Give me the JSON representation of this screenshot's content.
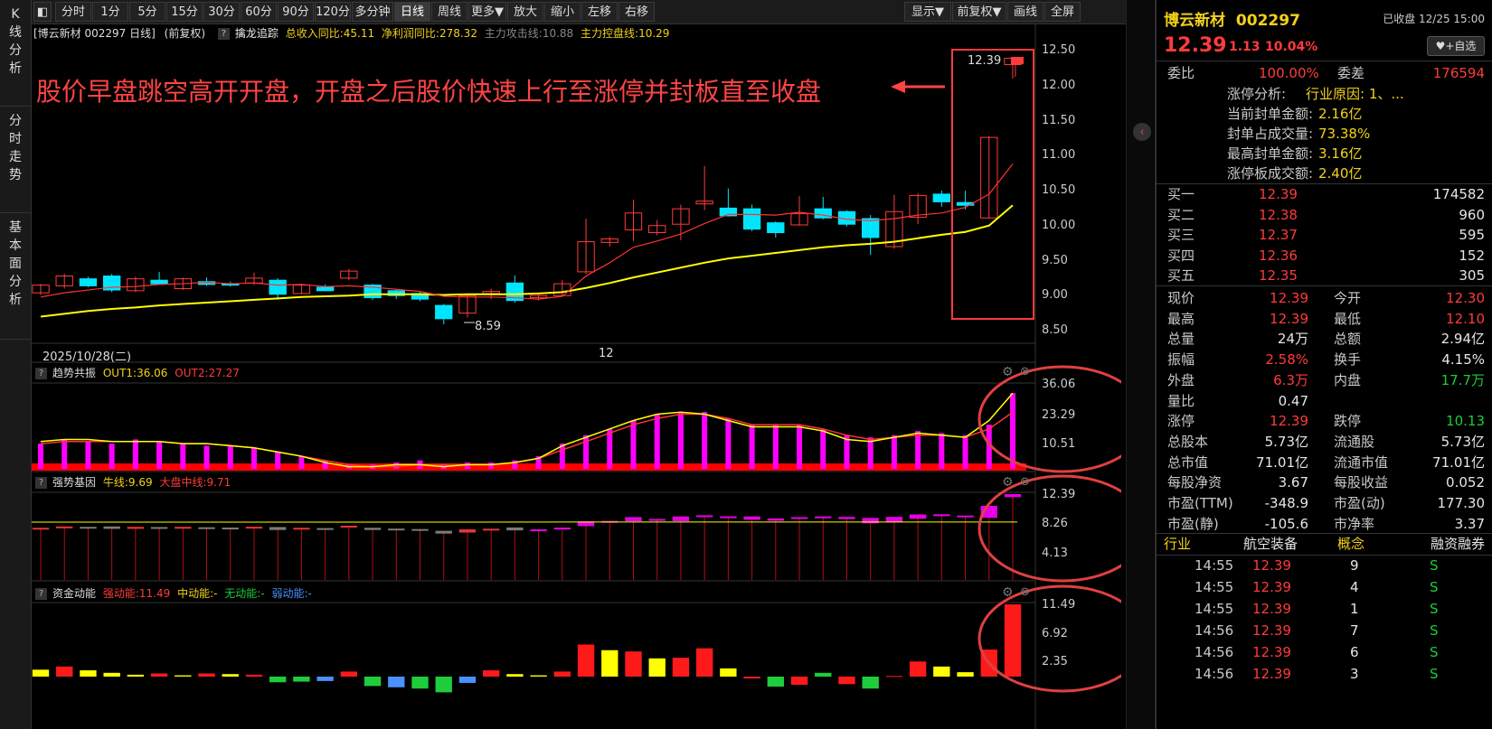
{
  "toolbar": {
    "buttons": [
      "分时",
      "1分",
      "5分",
      "15分",
      "30分",
      "60分",
      "90分",
      "120分",
      "多分钟",
      "日线",
      "周线",
      "更多▼",
      "放大",
      "缩小",
      "左移",
      "右移"
    ],
    "right_buttons": [
      "显示▼",
      "前复权▼",
      "画线",
      "全屏"
    ],
    "active": "日线"
  },
  "leftbar": {
    "tabs": [
      "K线分析",
      "分时走势",
      "基本面分析"
    ]
  },
  "chart_header": {
    "title": "[博云新材 002297 日线]",
    "adj": "(前复权)",
    "indicator": "擒龙追踪",
    "rev_growth": "总收入同比:45.11",
    "profit_growth": "净利润同比:278.32",
    "attack_line": "主力攻击线:10.88",
    "control_line": "主力控盘线:10.29"
  },
  "annotation": {
    "text": "股价早盘跳空高开开盘，开盘之后股价快速上行至涨停并封板直至收盘",
    "last_price_tag": "12.39",
    "low_label": "8.59"
  },
  "date_axis": {
    "left_label": "2025/10/28(二)",
    "mid_label": "12"
  },
  "price_axis": [
    "12.50",
    "12.00",
    "11.50",
    "11.00",
    "10.50",
    "10.00",
    "9.50",
    "9.00",
    "8.50"
  ],
  "panel1": {
    "name": "趋势共振",
    "out1": "OUT1:36.06",
    "out2": "OUT2:27.27",
    "axis": [
      "36.06",
      "23.29",
      "10.51"
    ]
  },
  "panel2": {
    "name": "强势基因",
    "bull": "牛线:9.69",
    "market": "大盘中线:9.71",
    "axis": [
      "12.39",
      "8.26",
      "4.13"
    ]
  },
  "panel3": {
    "name": "资金动能",
    "strong": "强动能:11.49",
    "mid": "中动能:-",
    "none": "无动能:-",
    "weak": "弱动能:-",
    "axis": [
      "11.49",
      "6.92",
      "2.35"
    ]
  },
  "colors": {
    "up": "#ff3b3b",
    "down": "#00e5ff",
    "ma_yellow": "#ffff00",
    "ma_red": "#ff3333",
    "magenta": "#ff00ff",
    "annotation": "#ff4444"
  },
  "chart_data": {
    "type": "candlestick",
    "candles": [
      [
        9.04,
        9.15,
        9.17,
        9.01
      ],
      [
        9.14,
        9.28,
        9.31,
        9.1
      ],
      [
        9.24,
        9.14,
        9.27,
        9.12
      ],
      [
        9.28,
        9.08,
        9.31,
        9.05
      ],
      [
        9.07,
        9.24,
        9.27,
        9.05
      ],
      [
        9.22,
        9.17,
        9.34,
        9.16
      ],
      [
        9.1,
        9.24,
        9.26,
        9.08
      ],
      [
        9.2,
        9.16,
        9.26,
        9.14
      ],
      [
        9.17,
        9.15,
        9.2,
        9.13
      ],
      [
        9.18,
        9.25,
        9.33,
        9.15
      ],
      [
        9.22,
        9.02,
        9.25,
        8.94
      ],
      [
        9.03,
        9.15,
        9.17,
        9.02
      ],
      [
        9.12,
        9.07,
        9.16,
        9.06
      ],
      [
        9.25,
        9.35,
        9.38,
        9.22
      ],
      [
        9.15,
        8.97,
        9.17,
        8.94
      ],
      [
        9.07,
        9.0,
        9.09,
        8.95
      ],
      [
        9.03,
        8.95,
        9.06,
        8.92
      ],
      [
        8.86,
        8.67,
        8.88,
        8.59
      ],
      [
        8.75,
        9.0,
        9.02,
        8.69
      ],
      [
        9.03,
        9.06,
        9.1,
        8.95
      ],
      [
        9.18,
        8.93,
        9.29,
        8.9
      ],
      [
        8.97,
        9.0,
        9.02,
        8.93
      ],
      [
        9.0,
        9.17,
        9.22,
        8.99
      ],
      [
        9.34,
        9.77,
        10.1,
        9.31
      ],
      [
        9.76,
        9.81,
        9.84,
        9.7
      ],
      [
        9.94,
        10.18,
        10.37,
        9.78
      ],
      [
        9.9,
        10.0,
        10.08,
        9.86
      ],
      [
        10.02,
        10.24,
        10.3,
        9.79
      ],
      [
        10.31,
        10.35,
        10.85,
        10.22
      ],
      [
        10.25,
        10.14,
        10.53,
        10.13
      ],
      [
        10.24,
        9.95,
        10.3,
        9.92
      ],
      [
        10.04,
        9.9,
        10.06,
        9.83
      ],
      [
        10.01,
        10.17,
        10.42,
        10.0
      ],
      [
        10.24,
        10.11,
        10.41,
        10.09
      ],
      [
        10.2,
        10.02,
        10.22,
        9.99
      ],
      [
        10.1,
        9.83,
        10.15,
        9.58
      ],
      [
        9.7,
        10.2,
        10.44,
        9.67
      ],
      [
        10.12,
        10.43,
        10.46,
        10.02
      ],
      [
        10.45,
        10.34,
        10.5,
        10.27
      ],
      [
        10.33,
        10.29,
        10.5,
        10.23
      ],
      [
        10.11,
        11.26,
        11.28,
        10.11
      ],
      [
        12.3,
        12.39,
        12.39,
        12.1
      ]
    ],
    "ma_yellow": [
      8.7,
      8.74,
      8.78,
      8.81,
      8.83,
      8.86,
      8.88,
      8.9,
      8.92,
      8.94,
      8.96,
      8.98,
      8.99,
      9.0,
      9.02,
      9.02,
      9.02,
      9.01,
      9.02,
      9.02,
      9.02,
      9.03,
      9.05,
      9.11,
      9.18,
      9.26,
      9.33,
      9.4,
      9.47,
      9.53,
      9.57,
      9.61,
      9.65,
      9.69,
      9.72,
      9.74,
      9.77,
      9.82,
      9.87,
      9.91,
      10.0,
      10.29
    ],
    "ma_red": [
      8.98,
      9.04,
      9.08,
      9.12,
      9.13,
      9.16,
      9.17,
      9.19,
      9.17,
      9.18,
      9.15,
      9.16,
      9.13,
      9.14,
      9.12,
      9.09,
      9.06,
      8.99,
      8.98,
      8.98,
      8.97,
      8.95,
      8.99,
      9.28,
      9.47,
      9.69,
      9.78,
      9.88,
      10.03,
      10.16,
      10.16,
      10.15,
      10.19,
      10.15,
      10.09,
      10.07,
      10.1,
      10.15,
      10.18,
      10.26,
      10.45,
      10.88
    ],
    "p1_bars": [
      12,
      14,
      13,
      12,
      14,
      13,
      12,
      11,
      11,
      10,
      8,
      6,
      4,
      2,
      2,
      3,
      4,
      2,
      3,
      3,
      4,
      6,
      12,
      16,
      19,
      23,
      26,
      27,
      27,
      24,
      21,
      21,
      21,
      19,
      16,
      15,
      16,
      18,
      17,
      16,
      21,
      36.06
    ],
    "p1_yellow": [
      13,
      14,
      14,
      13,
      13,
      13,
      12,
      12,
      11,
      10,
      8,
      6,
      3,
      1,
      1,
      2,
      2,
      1,
      2,
      2,
      3,
      5,
      11,
      15,
      19,
      23,
      26,
      27,
      26,
      23,
      20,
      20,
      20,
      18,
      14,
      13,
      15,
      17,
      16,
      15,
      23,
      36
    ],
    "p1_red": [
      12,
      13,
      13,
      13,
      13,
      13,
      12,
      12,
      11,
      10,
      8,
      6,
      4,
      2,
      1,
      1,
      2,
      2,
      2,
      2,
      3,
      5,
      9,
      13,
      17,
      21,
      24,
      26,
      26,
      24,
      21,
      21,
      21,
      19,
      16,
      14,
      15,
      16,
      16,
      15,
      19,
      27
    ],
    "p2_boxes": [
      [
        9.01,
        9.15
      ],
      [
        9.1,
        9.28
      ],
      [
        9.12,
        9.24
      ],
      [
        9.05,
        9.28
      ],
      [
        9.05,
        9.24
      ],
      [
        9.16,
        9.22
      ],
      [
        9.08,
        9.24
      ],
      [
        9.14,
        9.2
      ],
      [
        9.13,
        9.17
      ],
      [
        9.15,
        9.25
      ],
      [
        8.94,
        9.22
      ],
      [
        9.02,
        9.15
      ],
      [
        9.06,
        9.12
      ],
      [
        9.22,
        9.35
      ],
      [
        8.94,
        9.15
      ],
      [
        8.95,
        9.07
      ],
      [
        8.92,
        9.03
      ],
      [
        8.59,
        8.86
      ],
      [
        8.69,
        9.0
      ],
      [
        8.95,
        9.06
      ],
      [
        8.9,
        9.18
      ],
      [
        8.93,
        9.0
      ],
      [
        8.99,
        9.17
      ],
      [
        9.31,
        9.77
      ],
      [
        9.7,
        9.81
      ],
      [
        9.78,
        10.18
      ],
      [
        9.86,
        10.0
      ],
      [
        9.79,
        10.24
      ],
      [
        10.22,
        10.35
      ],
      [
        10.13,
        10.25
      ],
      [
        9.92,
        10.24
      ],
      [
        9.83,
        10.04
      ],
      [
        10.0,
        10.17
      ],
      [
        10.09,
        10.24
      ],
      [
        9.99,
        10.2
      ],
      [
        9.58,
        10.1
      ],
      [
        9.67,
        10.2
      ],
      [
        10.02,
        10.43
      ],
      [
        10.27,
        10.45
      ],
      [
        10.23,
        10.33
      ],
      [
        10.11,
        11.26
      ],
      [
        12.1,
        12.39
      ]
    ],
    "p3_values": [
      1.1,
      1.6,
      1.0,
      0.6,
      0.3,
      0.5,
      0.2,
      0.5,
      0.4,
      0.3,
      -0.9,
      -0.8,
      -0.7,
      0.8,
      -1.5,
      -1.7,
      -1.9,
      -2.5,
      -1.0,
      1.0,
      0.4,
      0.2,
      0.8,
      5.1,
      4.2,
      4.0,
      2.9,
      3.0,
      4.5,
      1.3,
      -0.3,
      -1.6,
      -1.3,
      0.6,
      -1.2,
      -1.9,
      0.1,
      2.4,
      1.6,
      0.7,
      4.3,
      11.49
    ],
    "p3_colors": [
      "yellow",
      "red",
      "yellow",
      "yellow",
      "yellow",
      "red",
      "yellow",
      "red",
      "yellow",
      "red",
      "green",
      "green",
      "blue",
      "red",
      "green",
      "blue",
      "green",
      "green",
      "blue",
      "red",
      "yellow",
      "yellow",
      "red",
      "red",
      "yellow",
      "red",
      "yellow",
      "red",
      "red",
      "yellow",
      "red",
      "green",
      "red",
      "green",
      "red",
      "green",
      "red",
      "red",
      "yellow",
      "yellow",
      "red",
      "red"
    ]
  },
  "stock": {
    "name": "博云新材",
    "code": "002297",
    "status": "已收盘 12/25 15:00",
    "price": "12.39",
    "change": "1.13",
    "pct": "10.04%",
    "fav_button": "+自选",
    "webi_label": "委比",
    "webi": "100.00%",
    "weicha_label": "委差",
    "weicha": "176594",
    "limit_up_analysis_label": "涨停分析:",
    "limit_up_analysis": "行业原因: 1、...",
    "seal_amount_label": "当前封单金额:",
    "seal_amount": "2.16亿",
    "seal_ratio_label": "封单占成交量:",
    "seal_ratio": "73.38%",
    "max_seal_label": "最高封单金额:",
    "max_seal": "3.16亿",
    "limit_turnover_label": "涨停板成交额:",
    "limit_turnover": "2.40亿"
  },
  "bids": [
    {
      "label": "买一",
      "price": "12.39",
      "vol": "174582"
    },
    {
      "label": "买二",
      "price": "12.38",
      "vol": "960"
    },
    {
      "label": "买三",
      "price": "12.37",
      "vol": "595"
    },
    {
      "label": "买四",
      "price": "12.36",
      "vol": "152"
    },
    {
      "label": "买五",
      "price": "12.35",
      "vol": "305"
    }
  ],
  "quote": [
    {
      "l1": "现价",
      "v1": "12.39",
      "c1": "red",
      "l2": "今开",
      "v2": "12.30",
      "c2": "red"
    },
    {
      "l1": "最高",
      "v1": "12.39",
      "c1": "red",
      "l2": "最低",
      "v2": "12.10",
      "c2": "red"
    },
    {
      "l1": "总量",
      "v1": "24万",
      "c1": "white",
      "l2": "总额",
      "v2": "2.94亿",
      "c2": "white"
    },
    {
      "l1": "振幅",
      "v1": "2.58%",
      "c1": "red",
      "l2": "换手",
      "v2": "4.15%",
      "c2": "white"
    },
    {
      "l1": "外盘",
      "v1": "6.3万",
      "c1": "red",
      "l2": "内盘",
      "v2": "17.7万",
      "c2": "green"
    },
    {
      "l1": "量比",
      "v1": "0.47",
      "c1": "white",
      "l2": "",
      "v2": "",
      "c2": "white"
    },
    {
      "l1": "涨停",
      "v1": "12.39",
      "c1": "red",
      "l2": "跌停",
      "v2": "10.13",
      "c2": "green"
    },
    {
      "l1": "总股本",
      "v1": "5.73亿",
      "c1": "white",
      "l2": "流通股",
      "v2": "5.73亿",
      "c2": "white"
    },
    {
      "l1": "总市值",
      "v1": "71.01亿",
      "c1": "white",
      "l2": "流通市值",
      "v2": "71.01亿",
      "c2": "white"
    },
    {
      "l1": "每股净资",
      "v1": "3.67",
      "c1": "white",
      "l2": "每股收益",
      "v2": "0.052",
      "c2": "white"
    },
    {
      "l1": "市盈(TTM)",
      "v1": "-348.9",
      "c1": "white",
      "l2": "市盈(动)",
      "v2": "177.30",
      "c2": "white"
    },
    {
      "l1": "市盈(静)",
      "v1": "-105.6",
      "c1": "white",
      "l2": "市净率",
      "v2": "3.37",
      "c2": "white"
    }
  ],
  "industry": {
    "label": "行业",
    "value": "航空装备",
    "concept_label": "概念",
    "margin_label": "融资融券"
  },
  "ticks": [
    {
      "time": "14:55",
      "price": "12.39",
      "vol": "9",
      "flag": "S"
    },
    {
      "time": "14:55",
      "price": "12.39",
      "vol": "4",
      "flag": "S"
    },
    {
      "time": "14:55",
      "price": "12.39",
      "vol": "1",
      "flag": "S"
    },
    {
      "time": "14:56",
      "price": "12.39",
      "vol": "7",
      "flag": "S"
    },
    {
      "time": "14:56",
      "price": "12.39",
      "vol": "6",
      "flag": "S"
    },
    {
      "time": "14:56",
      "price": "12.39",
      "vol": "3",
      "flag": "S"
    }
  ]
}
